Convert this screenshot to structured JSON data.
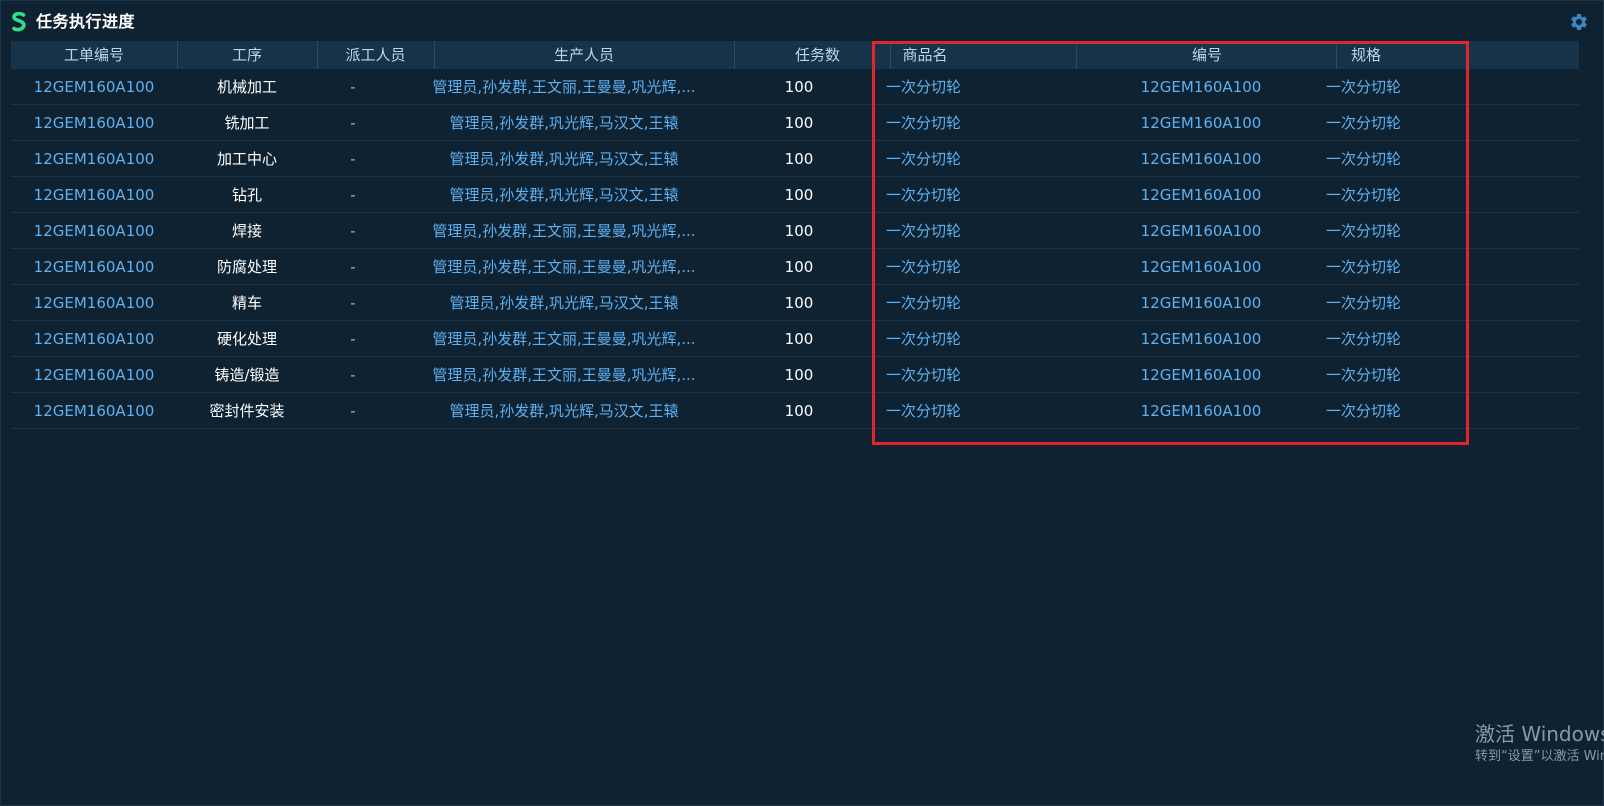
{
  "window": {
    "title": "任务执行进度"
  },
  "table": {
    "headers": [
      "工单编号",
      "工序",
      "派工人员",
      "生产人员",
      "任务数",
      "商品名",
      "编号",
      "规格"
    ],
    "rows": [
      [
        "12GEM160A100",
        "机械加工",
        "-",
        "管理员,孙发群,王文丽,王曼曼,巩光辉,...",
        "100",
        "一次分切轮",
        "12GEM160A100",
        "一次分切轮"
      ],
      [
        "12GEM160A100",
        "铣加工",
        "-",
        "管理员,孙发群,巩光辉,马汉文,王辕",
        "100",
        "一次分切轮",
        "12GEM160A100",
        "一次分切轮"
      ],
      [
        "12GEM160A100",
        "加工中心",
        "-",
        "管理员,孙发群,巩光辉,马汉文,王辕",
        "100",
        "一次分切轮",
        "12GEM160A100",
        "一次分切轮"
      ],
      [
        "12GEM160A100",
        "钻孔",
        "-",
        "管理员,孙发群,巩光辉,马汉文,王辕",
        "100",
        "一次分切轮",
        "12GEM160A100",
        "一次分切轮"
      ],
      [
        "12GEM160A100",
        "焊接",
        "-",
        "管理员,孙发群,王文丽,王曼曼,巩光辉,...",
        "100",
        "一次分切轮",
        "12GEM160A100",
        "一次分切轮"
      ],
      [
        "12GEM160A100",
        "防腐处理",
        "-",
        "管理员,孙发群,王文丽,王曼曼,巩光辉,...",
        "100",
        "一次分切轮",
        "12GEM160A100",
        "一次分切轮"
      ],
      [
        "12GEM160A100",
        "精车",
        "-",
        "管理员,孙发群,巩光辉,马汉文,王辕",
        "100",
        "一次分切轮",
        "12GEM160A100",
        "一次分切轮"
      ],
      [
        "12GEM160A100",
        "硬化处理",
        "-",
        "管理员,孙发群,王文丽,王曼曼,巩光辉,...",
        "100",
        "一次分切轮",
        "12GEM160A100",
        "一次分切轮"
      ],
      [
        "12GEM160A100",
        "铸造/锻造",
        "-",
        "管理员,孙发群,王文丽,王曼曼,巩光辉,...",
        "100",
        "一次分切轮",
        "12GEM160A100",
        "一次分切轮"
      ],
      [
        "12GEM160A100",
        "密封件安装",
        "-",
        "管理员,孙发群,巩光辉,马汉文,王辕",
        "100",
        "一次分切轮",
        "12GEM160A100",
        "一次分切轮"
      ]
    ]
  },
  "watermark": {
    "line1": "激活 Windows",
    "line2": "转到“设置”以激活 Windows。"
  },
  "colors": {
    "background": "#0f2232",
    "header_bg": "#17334a",
    "accent_blue": "#5eb1f0",
    "highlight_red": "#e1252a",
    "logo_green": "#2ee08a"
  },
  "icons": {
    "logo": "app-logo-icon",
    "settings": "gear-icon"
  }
}
